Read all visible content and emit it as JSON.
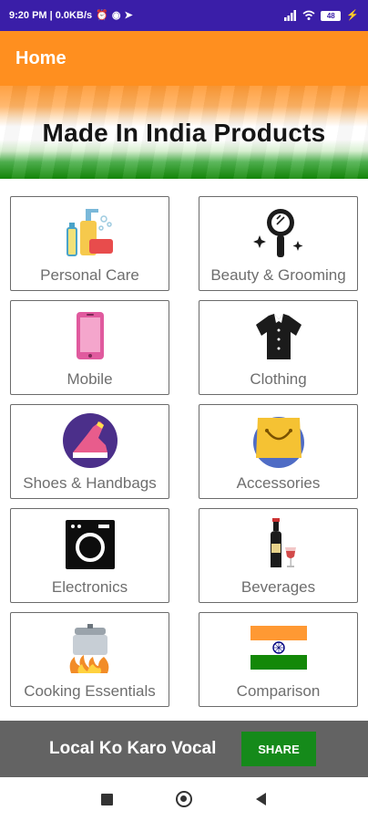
{
  "status_bar": {
    "time_and_speed": "9:20 PM | 0.0KB/s",
    "battery": "48"
  },
  "app_bar": {
    "title": "Home"
  },
  "banner": {
    "title": "Made In India Products"
  },
  "categories": [
    {
      "label": "Personal Care",
      "icon": "personal-care-icon"
    },
    {
      "label": "Beauty & Grooming",
      "icon": "mirror-icon"
    },
    {
      "label": "Mobile",
      "icon": "mobile-icon"
    },
    {
      "label": "Clothing",
      "icon": "shirt-icon"
    },
    {
      "label": "Shoes & Handbags",
      "icon": "shoe-icon"
    },
    {
      "label": "Accessories",
      "icon": "bag-icon"
    },
    {
      "label": "Electronics",
      "icon": "washing-machine-icon"
    },
    {
      "label": "Beverages",
      "icon": "wine-icon"
    },
    {
      "label": "Cooking Essentials",
      "icon": "cooker-icon"
    },
    {
      "label": "Comparison",
      "icon": "india-flag-icon"
    }
  ],
  "share_bar": {
    "text": "Local Ko Karo Vocal",
    "button_label": "SHARE"
  },
  "colors": {
    "status_bar": "#3a1ea8",
    "app_bar": "#ff8f1f",
    "share_bar": "#636363",
    "share_button": "#158a1a"
  }
}
